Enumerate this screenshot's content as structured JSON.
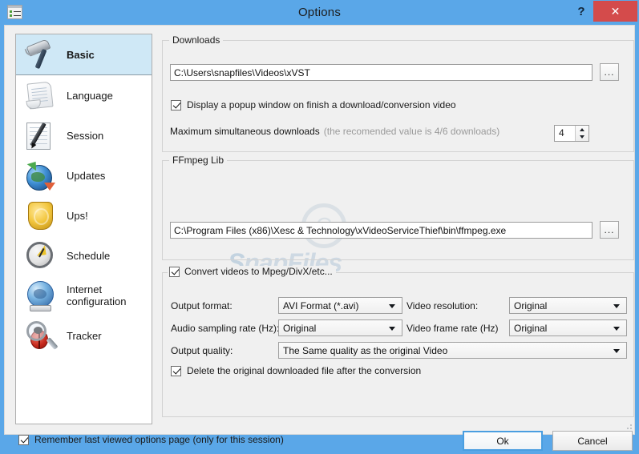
{
  "window": {
    "title": "Options",
    "app_icon": "options-list-icon",
    "help_label": "?",
    "close_label": "✕"
  },
  "sidebar": {
    "items": [
      {
        "label": "Basic",
        "icon": "hammer-icon",
        "selected": true
      },
      {
        "label": "Language",
        "icon": "document-icon",
        "selected": false
      },
      {
        "label": "Session",
        "icon": "notepad-pen-icon",
        "selected": false
      },
      {
        "label": "Updates",
        "icon": "globe-update-icon",
        "selected": false
      },
      {
        "label": "Ups!",
        "icon": "shield-icon",
        "selected": false
      },
      {
        "label": "Schedule",
        "icon": "clock-icon",
        "selected": false
      },
      {
        "label": "Internet configuration",
        "icon": "globe-network-icon",
        "selected": false
      },
      {
        "label": "Tracker",
        "icon": "bug-magnifier-icon",
        "selected": false
      }
    ]
  },
  "downloads": {
    "group_title": "Downloads",
    "path_value": "C:\\Users\\snapfiles\\Videos\\xVST",
    "browse_label": "...",
    "popup_checkbox": {
      "label": "Display a popup window on finish a download/conversion video",
      "checked": true
    },
    "max_downloads_label": "Maximum simultaneous downloads",
    "max_downloads_hint": "(the recomended value is 4/6 downloads)",
    "max_downloads_value": "4"
  },
  "ffmpeg": {
    "group_title": "FFmpeg Lib",
    "path_value": "C:\\Program Files (x86)\\Xesc & Technology\\xVideoServiceThief\\bin\\ffmpeg.exe",
    "browse_label": "..."
  },
  "convert": {
    "group_title": "Convert videos to Mpeg/DivX/etc...",
    "group_checked": true,
    "fields": [
      {
        "label": "Output format:",
        "value": "AVI Format (*.avi)"
      },
      {
        "label": "Video resolution:",
        "value": "Original"
      },
      {
        "label": "Audio sampling rate (Hz):",
        "value": "Original"
      },
      {
        "label": "Video frame rate (Hz)",
        "value": "Original"
      },
      {
        "label": "Output quality:",
        "value": "The Same quality as the original Video"
      }
    ],
    "delete_checkbox": {
      "label": "Delete the original downloaded file after the conversion",
      "checked": true
    }
  },
  "footer": {
    "remember_checkbox": {
      "label": "Remember last viewed options page (only for this session)",
      "checked": true
    },
    "ok_label": "Ok",
    "cancel_label": "Cancel"
  },
  "watermark": {
    "text_1": "S",
    "text_2": "napFiles"
  },
  "colors": {
    "titlebar": "#5aa7e8",
    "close_button": "#d44b4b",
    "selection": "#cfe8f6",
    "client_bg": "#f0f0f0",
    "focus_border": "#4a9ee0"
  }
}
